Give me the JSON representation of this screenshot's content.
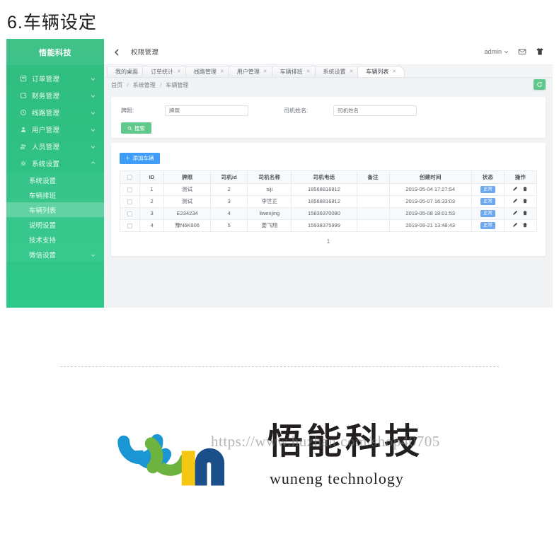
{
  "doc": {
    "heading": "6.车辆设定",
    "watermark": "https://www.huzhan.com/shop40705"
  },
  "sidebar": {
    "brand": "悟能科技",
    "items": [
      {
        "label": "订单管理",
        "icon": "clipboard-icon",
        "expandable": true
      },
      {
        "label": "财务管理",
        "icon": "wallet-icon",
        "expandable": true
      },
      {
        "label": "线路管理",
        "icon": "route-icon",
        "expandable": true
      },
      {
        "label": "用户管理",
        "icon": "user-icon",
        "expandable": true
      },
      {
        "label": "人员管理",
        "icon": "people-icon",
        "expandable": true
      },
      {
        "label": "系统设置",
        "icon": "gear-icon",
        "expandable": true,
        "open": true
      }
    ],
    "submenu": [
      {
        "label": "系统设置",
        "active": false,
        "expandable": false
      },
      {
        "label": "车辆排班",
        "active": false,
        "expandable": false
      },
      {
        "label": "车辆列表",
        "active": true,
        "expandable": false
      },
      {
        "label": "说明设置",
        "active": false,
        "expandable": false
      },
      {
        "label": "技术支持",
        "active": false,
        "expandable": false
      },
      {
        "label": "微信设置",
        "active": false,
        "expandable": true
      }
    ]
  },
  "topbar": {
    "title": "权限管理",
    "user": "admin",
    "back_icon": "chevron-left-icon",
    "mail_icon": "envelope-icon",
    "shirt_icon": "shirt-icon"
  },
  "tabs": [
    {
      "label": "我的桌面",
      "closable": false,
      "active": false
    },
    {
      "label": "订单统计",
      "closable": true,
      "active": false
    },
    {
      "label": "线路管理",
      "closable": true,
      "active": false
    },
    {
      "label": "用户管理",
      "closable": true,
      "active": false
    },
    {
      "label": "车辆排班",
      "closable": true,
      "active": false
    },
    {
      "label": "系统设置",
      "closable": true,
      "active": false
    },
    {
      "label": "车辆列表",
      "closable": true,
      "active": true
    }
  ],
  "breadcrumb": {
    "home": "首页",
    "level2": "系统管理",
    "current": "车辆管理",
    "separator": "/",
    "refresh_icon": "refresh-icon"
  },
  "search": {
    "plate_label": "牌照:",
    "plate_value": "",
    "plate_placeholder": "牌照",
    "driver_label": "司机姓名:",
    "driver_value": "",
    "driver_placeholder": "司机姓名",
    "button_label": "搜索",
    "button_icon": "search-icon"
  },
  "toolbar": {
    "add_label": "添加车辆",
    "add_icon": "plus-icon"
  },
  "table": {
    "columns": [
      "",
      "ID",
      "牌照",
      "司机id",
      "司机名称",
      "司机电话",
      "备注",
      "创建时间",
      "状态",
      "操作"
    ],
    "rows": [
      {
        "id": "1",
        "plate": "测试",
        "driver_id": "2",
        "driver_name": "siji",
        "phone": "18568816812",
        "note": "",
        "created": "2019-05-04 17:27:54",
        "status": "正常"
      },
      {
        "id": "2",
        "plate": "测试",
        "driver_id": "3",
        "driver_name": "李世正",
        "phone": "18568816812",
        "note": "",
        "created": "2019-05-07 16:33:03",
        "status": "正常"
      },
      {
        "id": "3",
        "plate": "E234234",
        "driver_id": "4",
        "driver_name": "liwenjing",
        "phone": "15836370080",
        "note": "",
        "created": "2019-05-08 18:01:53",
        "status": "正常"
      },
      {
        "id": "4",
        "plate": "豫N6K906",
        "driver_id": "5",
        "driver_name": "姜飞翔",
        "phone": "15938375999",
        "note": "",
        "created": "2019-09-21 13:48:43",
        "status": "正常"
      }
    ],
    "ops": {
      "edit_icon": "pencil-icon",
      "delete_icon": "trash-icon"
    }
  },
  "pagination": {
    "current": "1"
  },
  "logo": {
    "cn": "悟能科技",
    "en": "wuneng technology",
    "colors": {
      "blue": "#1b96d4",
      "green": "#6cb33f",
      "yellow": "#f6c712",
      "navy": "#1a4f8a"
    }
  },
  "colors": {
    "sidebar_green": "#2fc285",
    "accent_green": "#5fc98c",
    "accent_blue": "#3f9df7",
    "badge_blue": "#6ca7f0"
  }
}
